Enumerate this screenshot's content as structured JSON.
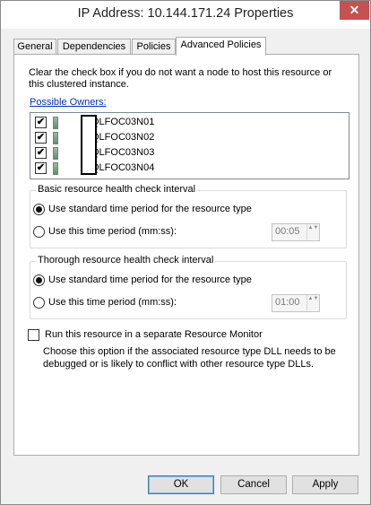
{
  "window": {
    "title": "IP Address: 10.144.171.24 Properties",
    "close_glyph": "✕"
  },
  "tabs": [
    {
      "label": "General"
    },
    {
      "label": "Dependencies"
    },
    {
      "label": "Policies"
    },
    {
      "label": "Advanced Policies"
    }
  ],
  "panel": {
    "description": "Clear the check box if you do not want a node to host this resource or this clustered instance.",
    "owners_link": "Possible Owners:",
    "owners": [
      {
        "name": "-SQLFOC03N01",
        "checked": true
      },
      {
        "name": "-SQLFOC03N02",
        "checked": true
      },
      {
        "name": "-SQLFOC03N03",
        "checked": true
      },
      {
        "name": "-SQLFOC03N04",
        "checked": true
      }
    ],
    "basic_group": {
      "title": "Basic resource health check interval",
      "opt1": "Use standard time period for the resource type",
      "opt2": "Use this time period (mm:ss):",
      "time": "00:05"
    },
    "thorough_group": {
      "title": "Thorough resource health check interval",
      "opt1": "Use standard time period for the resource type",
      "opt2": "Use this time period (mm:ss):",
      "time": "01:00"
    },
    "monitor": {
      "label": "Run this resource in a separate Resource Monitor",
      "description": "Choose this option if the associated resource type DLL needs to be debugged or is likely to conflict with other resource type DLLs.",
      "checked": false
    }
  },
  "buttons": {
    "ok": "OK",
    "cancel": "Cancel",
    "apply": "Apply"
  },
  "check_glyph": "✔",
  "spinner_arrows": "▲▼"
}
